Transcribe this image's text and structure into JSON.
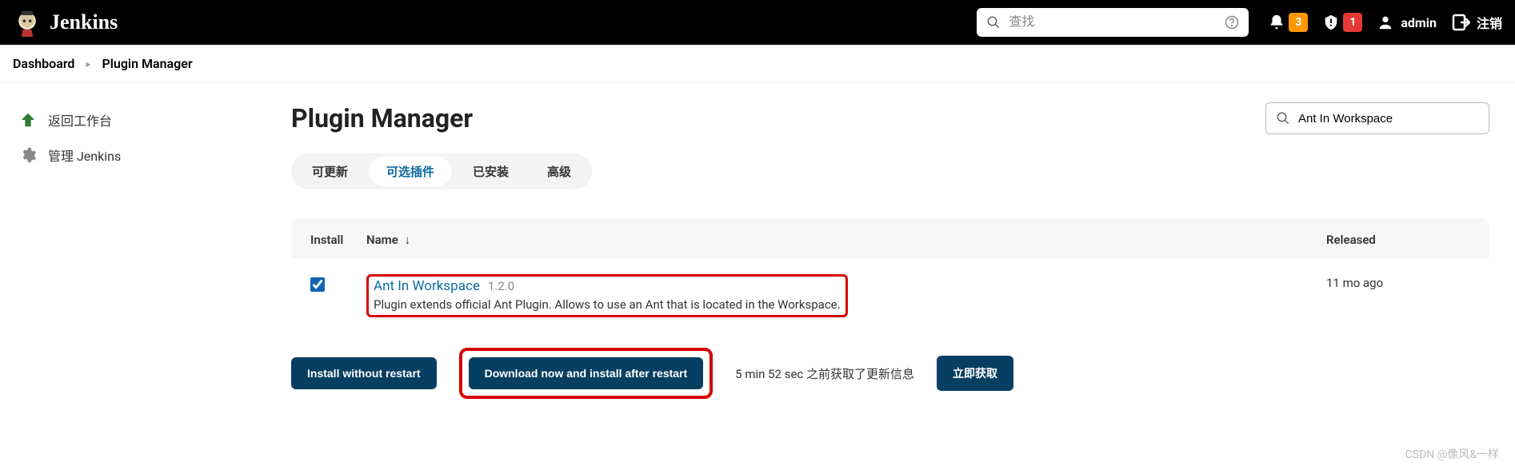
{
  "header": {
    "app_name": "Jenkins",
    "search_placeholder": "查找",
    "notifications_count": "3",
    "alerts_count": "1",
    "username": "admin",
    "logout_label": "注销"
  },
  "breadcrumbs": {
    "items": [
      "Dashboard",
      "Plugin Manager"
    ]
  },
  "sidebar": {
    "items": [
      {
        "label": "返回工作台"
      },
      {
        "label": "管理 Jenkins"
      }
    ]
  },
  "main": {
    "title": "Plugin Manager",
    "filter_value": "Ant In Workspace",
    "tabs": [
      {
        "label": "可更新",
        "active": false
      },
      {
        "label": "可选插件",
        "active": true
      },
      {
        "label": "已安装",
        "active": false
      },
      {
        "label": "高级",
        "active": false
      }
    ],
    "columns": {
      "install": "Install",
      "name": "Name",
      "released": "Released"
    },
    "plugins": [
      {
        "checked": true,
        "name": "Ant In Workspace",
        "version": "1.2.0",
        "description": "Plugin extends official Ant Plugin. Allows to use an Ant that is located in the Workspace.",
        "released": "11 mo ago"
      }
    ],
    "actions": {
      "install_without_restart": "Install without restart",
      "download_install_restart": "Download now and install after restart",
      "update_info": "5 min 52 sec 之前获取了更新信息",
      "fetch_now": "立即获取"
    }
  },
  "watermark": "CSDN @像风&一样"
}
